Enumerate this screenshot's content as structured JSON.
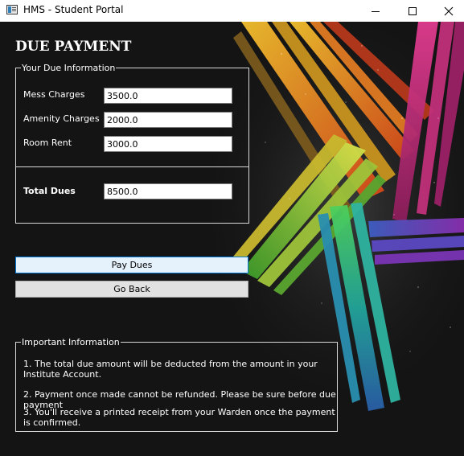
{
  "window": {
    "title": "HMS - Student Portal",
    "icons": {
      "app": "app-window-icon",
      "minimize": "minimize-icon",
      "maximize": "maximize-icon",
      "close": "close-icon"
    }
  },
  "page": {
    "heading": "DUE PAYMENT"
  },
  "due_info": {
    "legend": "Your Due Information",
    "mess_label": "Mess Charges",
    "mess_value": "3500.0",
    "amenity_label": "Amenity Charges",
    "amenity_value": "2000.0",
    "room_label": "Room Rent",
    "room_value": "3000.0",
    "total_label": "Total Dues",
    "total_value": "8500.0"
  },
  "actions": {
    "pay_label": "Pay Dues",
    "back_label": "Go Back"
  },
  "important": {
    "legend": "Important Information",
    "lines": [
      "1. The total due amount will be deducted from the amount in your Institute Account.",
      "2. Payment once made cannot be refunded. Please be sure before due payment",
      "3. You'll receive a printed receipt from your Warden once the payment is confirmed."
    ]
  }
}
